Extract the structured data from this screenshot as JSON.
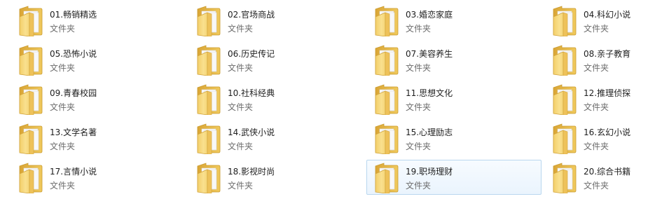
{
  "folders": [
    {
      "name": "01.畅销精选",
      "type": "文件夹"
    },
    {
      "name": "02.官场商战",
      "type": "文件夹"
    },
    {
      "name": "03.婚恋家庭",
      "type": "文件夹"
    },
    {
      "name": "04.科幻小说",
      "type": "文件夹"
    },
    {
      "name": "05.恐怖小说",
      "type": "文件夹"
    },
    {
      "name": "06.历史传记",
      "type": "文件夹"
    },
    {
      "name": "07.美容养生",
      "type": "文件夹"
    },
    {
      "name": "08.亲子教育",
      "type": "文件夹"
    },
    {
      "name": "09.青春校园",
      "type": "文件夹"
    },
    {
      "name": "10.社科经典",
      "type": "文件夹"
    },
    {
      "name": "11.思想文化",
      "type": "文件夹"
    },
    {
      "name": "12.推理侦探",
      "type": "文件夹"
    },
    {
      "name": "13.文学名著",
      "type": "文件夹"
    },
    {
      "name": "14.武侠小说",
      "type": "文件夹"
    },
    {
      "name": "15.心理励志",
      "type": "文件夹"
    },
    {
      "name": "16.玄幻小说",
      "type": "文件夹"
    },
    {
      "name": "17.言情小说",
      "type": "文件夹"
    },
    {
      "name": "18.影视时尚",
      "type": "文件夹"
    },
    {
      "name": "19.职场理财",
      "type": "文件夹",
      "selected": true
    },
    {
      "name": "20.综合书籍",
      "type": "文件夹"
    }
  ],
  "icons": {
    "folder": "folder-icon"
  },
  "colors": {
    "folder_front": "#f6d77a",
    "folder_back": "#e7b946",
    "selection_bg": "#eaf4fd",
    "selection_border": "#b9d7ef"
  }
}
